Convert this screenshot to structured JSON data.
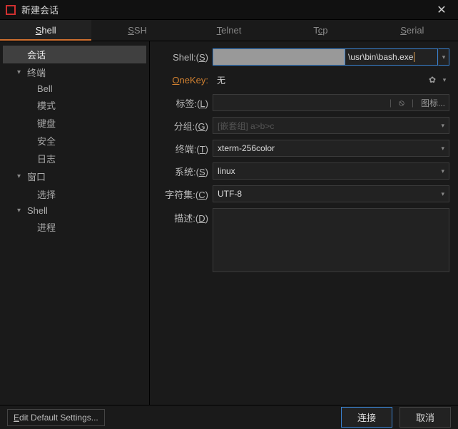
{
  "window": {
    "title": "新建会话"
  },
  "tabs": [
    {
      "label": "Shell",
      "ul": "S"
    },
    {
      "label": "SSH",
      "ul": "S"
    },
    {
      "label": "Telnet",
      "ul": "T"
    },
    {
      "label": "Tcp",
      "ul": "c"
    },
    {
      "label": "Serial",
      "ul": "S"
    }
  ],
  "sidebar": {
    "items": [
      {
        "label": "会话",
        "level": 1,
        "chev": "",
        "active": true
      },
      {
        "label": "终端",
        "level": 1,
        "chev": "▾"
      },
      {
        "label": "Bell",
        "level": 2
      },
      {
        "label": "模式",
        "level": 2
      },
      {
        "label": "键盘",
        "level": 2
      },
      {
        "label": "安全",
        "level": 2
      },
      {
        "label": "日志",
        "level": 2
      },
      {
        "label": "窗口",
        "level": 1,
        "chev": "▾"
      },
      {
        "label": "选择",
        "level": 2
      },
      {
        "label": "Shell",
        "level": 1,
        "chev": "▾"
      },
      {
        "label": "进程",
        "level": 2
      }
    ]
  },
  "form": {
    "shell": {
      "label": "Shell:",
      "hotkey": "S",
      "value": "\\usr\\bin\\bash.exe"
    },
    "onekey": {
      "label_pre": "O",
      "label_post": "neKey:",
      "value": "无"
    },
    "tag": {
      "label": "标签:",
      "hotkey": "L",
      "value": "",
      "icon_label": "图标..."
    },
    "group": {
      "label": "分组:",
      "hotkey": "G",
      "placeholder": "[嵌套组] a>b>c"
    },
    "term": {
      "label": "终端:",
      "hotkey": "T",
      "value": "xterm-256color"
    },
    "system": {
      "label": "系统:",
      "hotkey": "S",
      "value": "linux"
    },
    "charset": {
      "label": "字符集:",
      "hotkey": "C",
      "value": "UTF-8"
    },
    "desc": {
      "label": "描述:",
      "hotkey": "D",
      "value": ""
    }
  },
  "footer": {
    "edit_defaults_pre": "E",
    "edit_defaults_post": "dit Default Settings...",
    "connect": "连接",
    "cancel": "取消"
  }
}
